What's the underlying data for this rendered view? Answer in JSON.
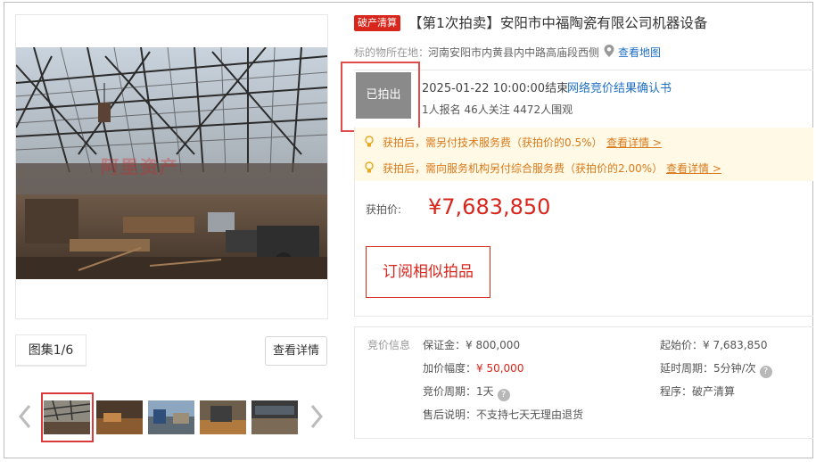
{
  "header": {
    "badge": "破产清算",
    "title": "【第1次拍卖】安阳市中福陶瓷有限公司机器设备",
    "location_label": "标的物所在地：",
    "location_value": "河南安阳市内黄县内中路高庙段西侧",
    "map_link": "查看地图"
  },
  "status": {
    "label": "已拍出",
    "end_time": "2025-01-22 10:00:00结束",
    "result_link": "网络竞价结果确认书",
    "stats": "1人报名  46人关注  4472人围观"
  },
  "notices": [
    {
      "text": "获拍后，需另付技术服务费（获拍价的0.5%）",
      "link": "查看详情 >"
    },
    {
      "text": "获拍后，需向服务机构另付综合服务费（获拍价的2.00%）",
      "link": "查看详情 >"
    }
  ],
  "price": {
    "label": "获拍价:",
    "value": "¥7,683,850"
  },
  "subscribe_button": "订阅相似拍品",
  "gallery": {
    "tab_label": "图集1/6",
    "detail_button": "查看详情",
    "watermark": "阿里资产"
  },
  "bid_info": {
    "heading": "竞价信息",
    "deposit": "保证金：¥ 800,000",
    "start_price": "起始价：¥ 7,683,850",
    "increment_label": "加价幅度：",
    "increment_value": "¥ 50,000",
    "delay": "延时周期：5分钟/次",
    "cycle": "竞价周期：1天",
    "procedure": "程序：破产清算",
    "after_sale": "售后说明：不支持七天无理由退货"
  },
  "colors": {
    "accent_red": "#d9261c",
    "link_blue": "#1f6fc5",
    "notice_orange": "#d87a1b",
    "notice_bg": "#fff9e6",
    "status_gray": "#8a8a8a"
  }
}
